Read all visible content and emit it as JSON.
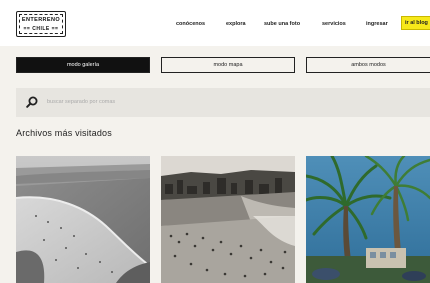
{
  "header": {
    "logo_top": "ENTERRENO",
    "logo_bottom": "== CHILE ==",
    "nav": [
      "conócenos",
      "explora",
      "sube una foto",
      "servicios",
      "ingresar"
    ],
    "blog_label": "ir al blog"
  },
  "modes": [
    "modo galería",
    "modo mapa",
    "ambos modos"
  ],
  "search": {
    "placeholder": "buscar separado por comas"
  },
  "section": {
    "title": "Archivos más visitados"
  },
  "colors": {
    "accent_yellow": "#f7e91a",
    "background": "#f4f2ed",
    "search_bg": "#e7e5e0"
  }
}
